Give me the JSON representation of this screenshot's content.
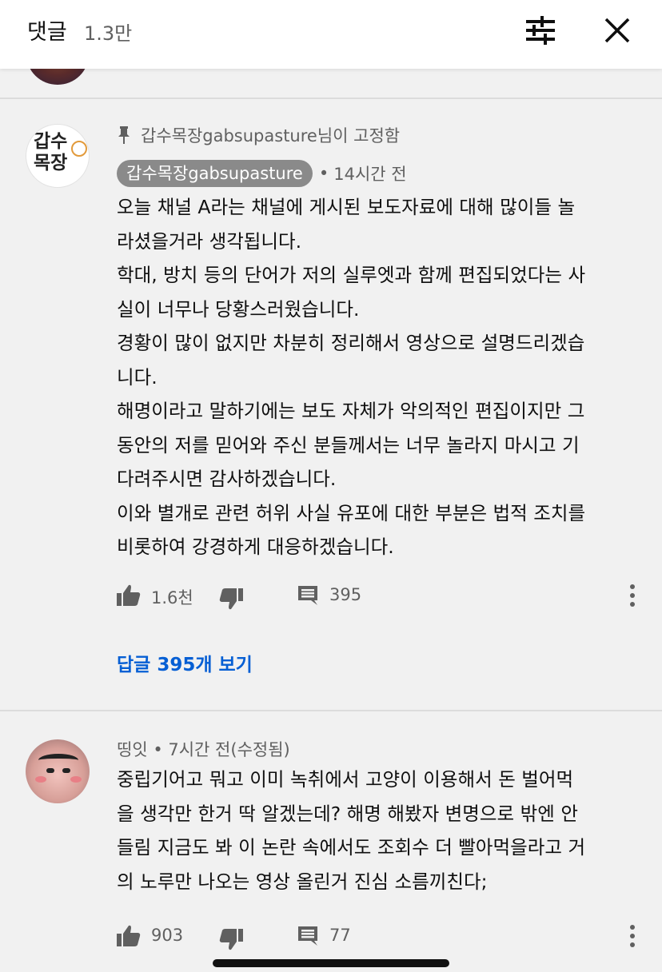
{
  "header": {
    "title": "댓글",
    "count": "1.3만"
  },
  "comments": [
    {
      "pinned_text": "갑수목장gabsupasture님이 고정함",
      "author": "갑수목장gabsupasture",
      "time": "14시간 전",
      "avatar_text": "갑수 목장",
      "lines": [
        "오늘 채널 A라는 채널에 게시된 보도자료에 대해 많이들 놀",
        "라셨을거라 생각됩니다.",
        "학대, 방치 등의 단어가 저의 실루엣과 함께 편집되었다는 사",
        "실이 너무나 당황스러웠습니다.",
        "경황이 많이 없지만 차분히 정리해서 영상으로 설명드리겠습",
        "니다.",
        "해명이라고 말하기에는 보도 자체가 악의적인 편집이지만 그",
        "동안의 저를 믿어와 주신 분들께서는 너무 놀라지 마시고 기",
        "다려주시면 감사하겠습니다.",
        "이와 별개로 관련 허위 사실 유포에 대한 부분은 법적 조치를",
        "비롯하여 강경하게 대응하겠습니다."
      ],
      "likes": "1.6천",
      "replies": "395",
      "view_replies_label": "답글 395개 보기"
    },
    {
      "author_meta": "띵잇 • 7시간 전(수정됨)",
      "lines": [
        "중립기어고 뭐고 이미 녹취에서 고양이 이용해서 돈 벌어먹",
        "을 생각만 한거 딱 알겠는데? 해명 해봤자 변명으로 밖엔 안",
        "들림 지금도 봐 이 논란 속에서도 조회수 더 빨아먹을라고 거",
        "의 노루만 나오는 영상 올린거 진심 소름끼친다;"
      ],
      "likes": "903",
      "replies": "77"
    }
  ],
  "icons": {
    "filter": "tune-icon",
    "close": "close-icon",
    "pin": "pin-icon",
    "like": "thumb-up-icon",
    "dislike": "thumb-down-icon",
    "reply": "comment-icon",
    "more": "more-vert-icon"
  },
  "colors": {
    "accent_link": "#065fd4",
    "background": "#f1f1f1",
    "secondary_text": "#606060"
  }
}
